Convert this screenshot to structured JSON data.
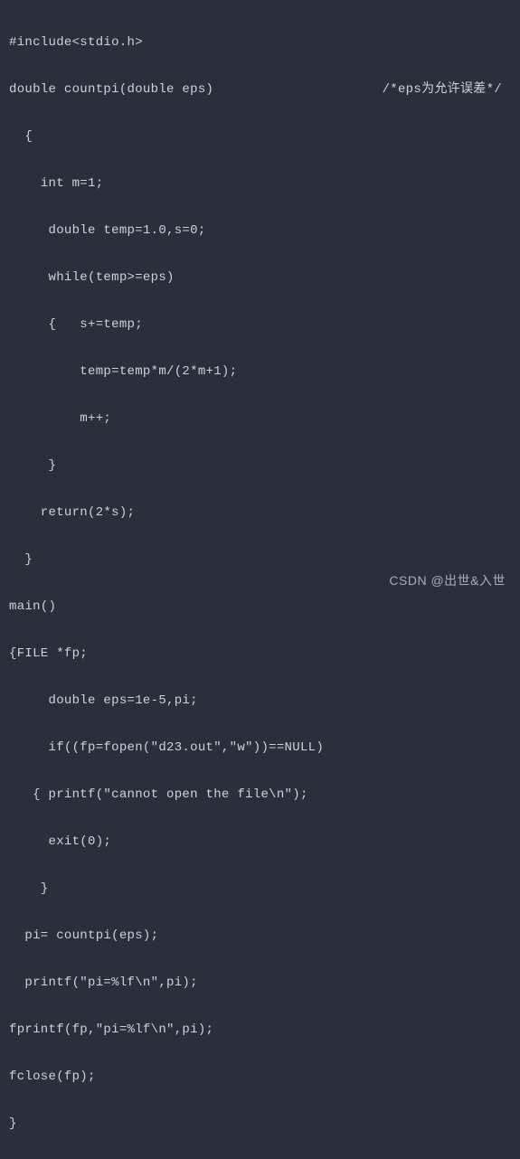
{
  "code": {
    "lines": [
      "#include<stdio.h>",
      "double countpi(double eps)",
      "  {",
      "    int m=1;",
      "     double temp=1.0,s=0;",
      "     while(temp>=eps)",
      "     {   s+=temp;",
      "         temp=temp*m/(2*m+1);",
      "         m++;",
      "     }",
      "    return(2*s);",
      "  }",
      "main()",
      "{FILE *fp;",
      "     double eps=1e-5,pi;",
      "     if((fp=fopen(\"d23.out\",\"w\"))==NULL)",
      "   { printf(\"cannot open the file\\n\");",
      "     exit(0);",
      "    }",
      "  pi= countpi(eps);",
      "  printf(\"pi=%lf\\n\",pi);",
      "fprintf(fp,\"pi=%lf\\n\",pi);",
      "fclose(fp);",
      "}"
    ],
    "comment": "/*eps为允许误差*/"
  },
  "watermark": "CSDN @出世&入世"
}
